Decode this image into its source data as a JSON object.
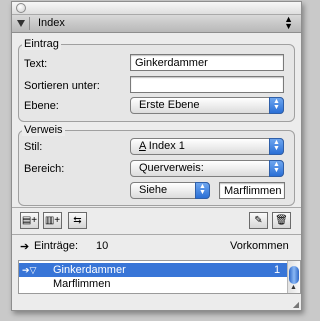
{
  "palette": {
    "header_title": "Index",
    "eintrag": {
      "group_label": "Eintrag",
      "text_label": "Text:",
      "text_value": "Ginkerdammer",
      "sort_label": "Sortieren unter:",
      "sort_value": "",
      "level_label": "Ebene:",
      "level_value": "Erste Ebene"
    },
    "verweis": {
      "group_label": "Verweis",
      "style_label": "Stil:",
      "style_value": "Index 1",
      "range_label": "Bereich:",
      "range_value": "Querverweis:",
      "see_value": "Siehe",
      "crossref_value": "Marflimmen"
    },
    "toolbar": {
      "add_entry_glyph": "▤+",
      "add_rev_glyph": "▥+",
      "move_glyph": "⇆",
      "edit_glyph": "✎",
      "delete_glyph": "🗑"
    },
    "list": {
      "entries_label": "Einträge:",
      "entries_count": "10",
      "occurrences_label": "Vorkommen",
      "rows": [
        {
          "name": "Ginkerdammer",
          "count": "1",
          "selected": true
        },
        {
          "name": "Marflimmen",
          "count": "",
          "selected": false
        }
      ]
    }
  },
  "colors": {
    "selection": "#3875d7",
    "aqua_stepper": "#2a6fd6"
  }
}
